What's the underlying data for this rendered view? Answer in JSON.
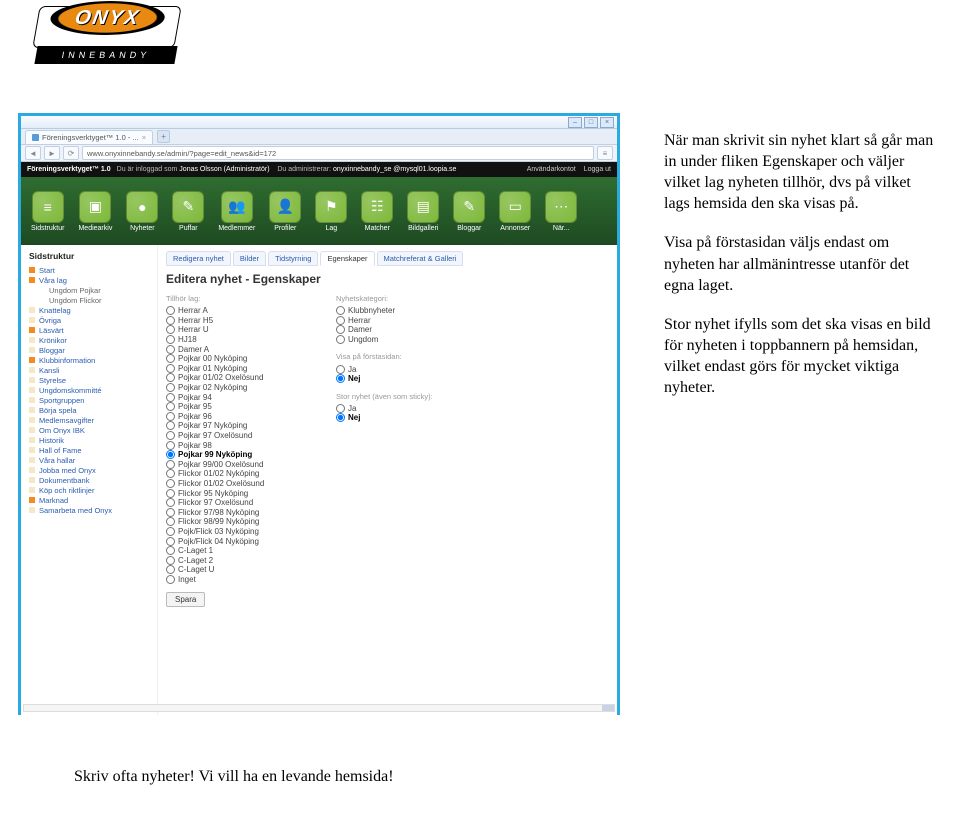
{
  "logo": {
    "main": "ONYX",
    "sub": "INNEBANDY"
  },
  "browser": {
    "tab_title": "Föreningsverktyget™ 1.0 - ...",
    "url": "www.onyxinnebandy.se/admin/?page=edit_news&id=172"
  },
  "appbar": {
    "title": "Föreningsverktyget™ 1.0",
    "logged_in_prefix": "Du är inloggad som",
    "user": "Jonas Olsson (Administratör)",
    "admin_prefix": "Du administrerar:",
    "site": "onyxinnebandy_se @mysql01.loopia.se",
    "links": [
      "Användarkontot",
      "Logga ut"
    ]
  },
  "iconbar": [
    {
      "label": "Sidstruktur",
      "glyph": "≡"
    },
    {
      "label": "Mediearkiv",
      "glyph": "▣"
    },
    {
      "label": "Nyheter",
      "glyph": "●"
    },
    {
      "label": "Puffar",
      "glyph": "✎"
    },
    {
      "label": "Medlemmer",
      "glyph": "👥"
    },
    {
      "label": "Profiler",
      "glyph": "👤"
    },
    {
      "label": "Lag",
      "glyph": "⚑"
    },
    {
      "label": "Matcher",
      "glyph": "☷"
    },
    {
      "label": "Bildgalleri",
      "glyph": "▤"
    },
    {
      "label": "Bloggar",
      "glyph": "✎"
    },
    {
      "label": "Annonser",
      "glyph": "▭"
    },
    {
      "label": "När...",
      "glyph": "⋯"
    }
  ],
  "sidebar_title": "Sidstruktur",
  "sidebar": [
    {
      "t": "Start",
      "b": "b-orange"
    },
    {
      "t": "Våra lag",
      "b": "b-orange"
    },
    {
      "t": "Ungdom Pojkar",
      "b": "",
      "sub": true
    },
    {
      "t": "Ungdom Flickor",
      "b": "",
      "sub": true
    },
    {
      "t": "Knattelag",
      "b": "b-cream"
    },
    {
      "t": "Övriga",
      "b": "b-cream"
    },
    {
      "t": "Läsvärt",
      "b": "b-orange"
    },
    {
      "t": "Krönikor",
      "b": "b-cream"
    },
    {
      "t": "Bloggar",
      "b": "b-cream"
    },
    {
      "t": "Klubbinformation",
      "b": "b-orange"
    },
    {
      "t": "Kansli",
      "b": "b-cream"
    },
    {
      "t": "Styrelse",
      "b": "b-cream"
    },
    {
      "t": "Ungdomskommitté",
      "b": "b-cream"
    },
    {
      "t": "Sportgruppen",
      "b": "b-cream"
    },
    {
      "t": "Börja spela",
      "b": "b-cream"
    },
    {
      "t": "Medlemsavgifter",
      "b": "b-cream"
    },
    {
      "t": "Om Onyx IBK",
      "b": "b-cream"
    },
    {
      "t": "Historik",
      "b": "b-cream"
    },
    {
      "t": "Hall of Fame",
      "b": "b-cream"
    },
    {
      "t": "Våra hallar",
      "b": "b-cream"
    },
    {
      "t": "Jobba med Onyx",
      "b": "b-cream"
    },
    {
      "t": "Dokumentbank",
      "b": "b-cream"
    },
    {
      "t": "Köp och riktlinjer",
      "b": "b-cream"
    },
    {
      "t": "Marknad",
      "b": "b-orange"
    },
    {
      "t": "Samarbeta med Onyx",
      "b": "b-cream"
    }
  ],
  "tabs2": [
    "Redigera nyhet",
    "Bilder",
    "Tidstyrning",
    "Egenskaper",
    "Matchreferat & Galleri"
  ],
  "tabs2_active": "Egenskaper",
  "heading": "Editera nyhet - Egenskaper",
  "col1_label": "Tillhör lag:",
  "col1": [
    "Herrar A",
    "Herrar H5",
    "Herrar U",
    "HJ18",
    "Damer A",
    "Pojkar 00 Nyköping",
    "Pojkar 01 Nyköping",
    "Pojkar 01/02 Oxelösund",
    "Pojkar 02 Nyköping",
    "Pojkar 94",
    "Pojkar 95",
    "Pojkar 96",
    "Pojkar 97 Nyköping",
    "Pojkar 97 Oxelösund",
    "Pojkar 98",
    "Pojkar 99 Nyköping",
    "Pojkar 99/00 Oxelösund",
    "Flickor 01/02 Nyköping",
    "Flickor 01/02 Oxelösund",
    "Flickor 95 Nyköping",
    "Flickor 97 Oxelösund",
    "Flickor 97/98 Nyköping",
    "Flickor 98/99 Nyköping",
    "Pojk/Flick 03 Nyköping",
    "Pojk/Flick 04 Nyköping",
    "C-Laget 1",
    "C-Laget 2",
    "C-Laget U",
    "Inget"
  ],
  "col1_selected": "Pojkar 99 Nyköping",
  "col2_label": "Nyhetskategori:",
  "col2": [
    "Klubbnyheter",
    "Herrar",
    "Damer",
    "Ungdom"
  ],
  "firstpage": {
    "label": "Visa på förstasidan:",
    "options": [
      "Ja",
      "Nej"
    ],
    "selected": "Nej"
  },
  "bignews": {
    "label": "Stor nyhet (även som sticky):",
    "options": [
      "Ja",
      "Nej"
    ],
    "selected": "Nej"
  },
  "save": "Spara",
  "instructions": {
    "p1": "När man skrivit sin nyhet klart så går man in under fliken Egenskaper och väljer vilket lag nyheten tillhör, dvs på vilket lags hemsida den ska visas på.",
    "p2": "Visa på förstasidan väljs endast om nyheten har allmänintresse utanför det egna laget.",
    "p3": "Stor nyhet ifylls som det ska visas en bild för nyheten i toppbannern på hemsidan, vilket endast görs för mycket viktiga nyheter."
  },
  "bottom": "Skriv ofta nyheter! Vi vill ha en levande hemsida!"
}
